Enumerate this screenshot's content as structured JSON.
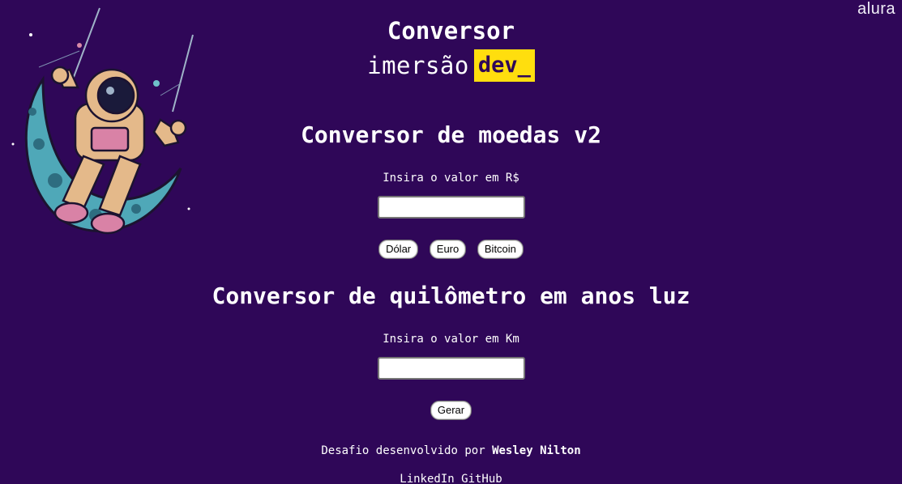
{
  "brand": {
    "name": "alura"
  },
  "header": {
    "title": "Conversor",
    "logo_text": "imersão",
    "logo_tag": "dev_"
  },
  "currency": {
    "heading": "Conversor de moedas v2",
    "label": "Insira o valor em R$",
    "input_value": "",
    "buttons": [
      "Dólar",
      "Euro",
      "Bitcoin"
    ]
  },
  "distance": {
    "heading": "Conversor de quilômetro em anos luz",
    "label": "Insira o valor em Km",
    "input_value": "",
    "button": "Gerar"
  },
  "footer": {
    "text": "Desafio desenvolvido por",
    "author": "Wesley Nilton",
    "links": [
      "LinkedIn",
      "GitHub"
    ]
  },
  "colors": {
    "background": "#2f0758",
    "accent": "#ffde0e",
    "text": "#ffffff"
  },
  "illustration": {
    "icon": "astronaut-on-moon-swing"
  }
}
